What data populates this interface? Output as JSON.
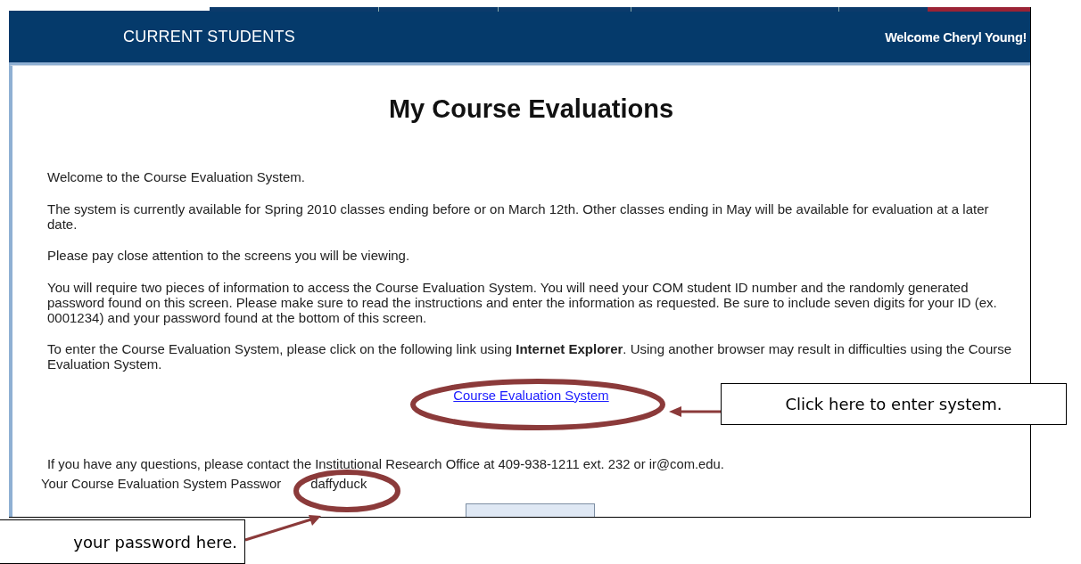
{
  "header": {
    "section_title": "CURRENT STUDENTS",
    "welcome": "Welcome Cheryl Young!"
  },
  "page": {
    "title": "My Course Evaluations",
    "paragraphs": [
      "Welcome to the Course Evaluation System.",
      "The system is currently available for Spring 2010 classes ending before or on March 12th. Other classes ending in May will be available for evaluation at a later date.",
      "Please pay close attention to the screens you will be viewing.",
      "You will require two pieces of information to access the Course Evaluation System. You will need your COM student ID number and the randomly generated password found on this screen. Please make sure to read the instructions and enter the information as requested. Be sure to include seven digits for your ID (ex. 0001234) and your password found at the bottom of this screen.",
      "To enter the Course Evaluation System, please click on the following link using **Internet Explorer**. Using another browser may result in difficulties using the Course Evaluation System."
    ],
    "link": "Course Evaluation System",
    "contact": "If you have any questions, please contact the Institutional Research Office at 409-938-1211 ext. 232 or ir@com.edu.",
    "password_label": "Your Course Evaluation System Passwor",
    "password": "daffyduck"
  },
  "callouts": [
    {
      "kind": "link",
      "text": "Click here to enter system."
    },
    {
      "kind": "password",
      "text": "your password here."
    }
  ]
}
